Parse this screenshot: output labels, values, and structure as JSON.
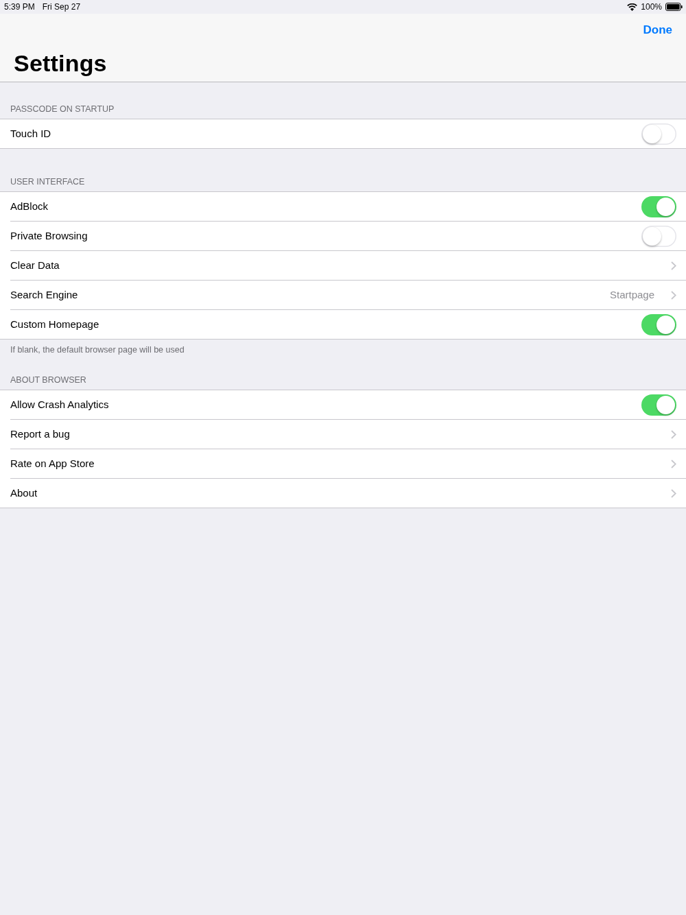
{
  "status_bar": {
    "time": "5:39 PM",
    "date": "Fri Sep 27",
    "battery": "100%"
  },
  "nav": {
    "done": "Done",
    "title": "Settings"
  },
  "sections": [
    {
      "header": "PASSCODE ON STARTUP",
      "rows": [
        {
          "kind": "toggle",
          "label": "Touch ID",
          "on": false
        }
      ]
    },
    {
      "header": "USER INTERFACE",
      "rows": [
        {
          "kind": "toggle",
          "label": "AdBlock",
          "on": true
        },
        {
          "kind": "toggle",
          "label": "Private Browsing",
          "on": false
        },
        {
          "kind": "link",
          "label": "Clear Data"
        },
        {
          "kind": "link",
          "label": "Search Engine",
          "value": "Startpage"
        },
        {
          "kind": "toggle",
          "label": "Custom Homepage",
          "on": true
        }
      ],
      "footer": "If blank, the default browser page will be used"
    },
    {
      "header": "ABOUT BROWSER",
      "rows": [
        {
          "kind": "toggle",
          "label": "Allow Crash Analytics",
          "on": true
        },
        {
          "kind": "link",
          "label": "Report a bug"
        },
        {
          "kind": "link",
          "label": "Rate on App Store"
        },
        {
          "kind": "link",
          "label": "About"
        }
      ]
    }
  ]
}
